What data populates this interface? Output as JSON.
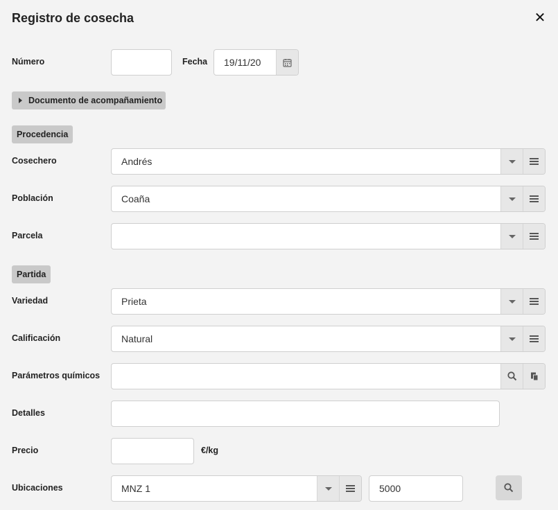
{
  "dialog": {
    "title": "Registro de cosecha"
  },
  "fields": {
    "numero": {
      "label": "Número",
      "value": ""
    },
    "fecha": {
      "label": "Fecha",
      "value": "19/11/20"
    },
    "cosechero": {
      "label": "Cosechero",
      "value": "Andrés"
    },
    "poblacion": {
      "label": "Población",
      "value": "Coaña"
    },
    "parcela": {
      "label": "Parcela",
      "value": ""
    },
    "variedad": {
      "label": "Variedad",
      "value": "Prieta"
    },
    "calificacion": {
      "label": "Calificación",
      "value": "Natural"
    },
    "parametros": {
      "label": "Parámetros químicos",
      "value": ""
    },
    "detalles": {
      "label": "Detalles",
      "value": ""
    },
    "precio": {
      "label": "Precio",
      "value": "",
      "unit": "€/kg"
    },
    "ubicaciones": {
      "label": "Ubicaciones",
      "value": "MNZ 1",
      "quantity": "5000"
    }
  },
  "buttons": {
    "documento": "Documento de acompañamiento"
  },
  "sections": {
    "procedencia": "Procedencia",
    "partida": "Partida"
  }
}
